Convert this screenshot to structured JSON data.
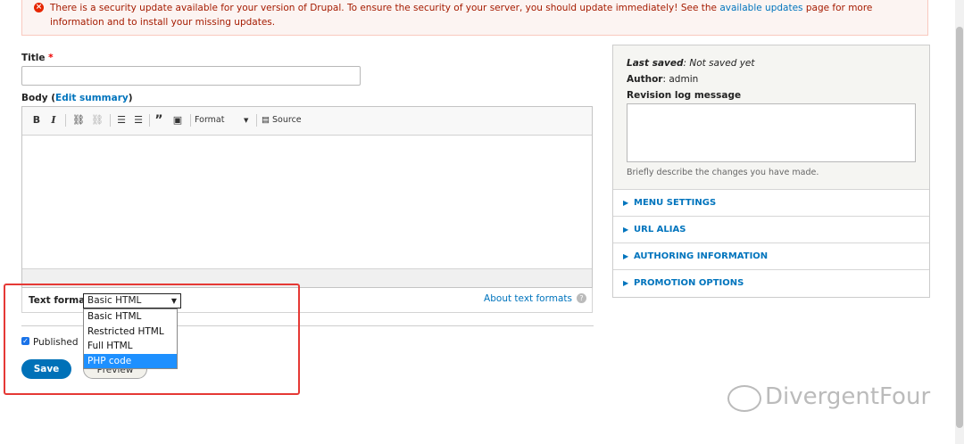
{
  "alert": {
    "text_before": "There is a security update available for your version of Drupal. To ensure the security of your server, you should update immediately! See the ",
    "link": "available updates",
    "text_after": " page for more information and to install your missing updates."
  },
  "form": {
    "title_label": "Title",
    "required_mark": "*",
    "title_value": "",
    "body_label": "Body (",
    "edit_summary": "Edit summary",
    "body_label_close": ")",
    "toolbar": {
      "bold": "B",
      "italic": "I",
      "format": "Format",
      "source": "Source"
    },
    "text_format_label": "Text format",
    "text_format_value": "Basic HTML",
    "text_format_options": [
      "Basic HTML",
      "Restricted HTML",
      "Full HTML",
      "PHP code"
    ],
    "text_format_highlighted": "PHP code",
    "about_text_formats": "About text formats",
    "published_label": "Published",
    "published_checked": true,
    "save_button": "Save",
    "preview_button": "Preview"
  },
  "sidebar": {
    "last_saved_label": "Last saved",
    "last_saved_value": ": Not saved yet",
    "author_label": "Author",
    "author_value": ": admin",
    "revision_label": "Revision log message",
    "revision_desc": "Briefly describe the changes you have made.",
    "sections": [
      "MENU SETTINGS",
      "URL ALIAS",
      "AUTHORING INFORMATION",
      "PROMOTION OPTIONS"
    ]
  },
  "watermark": "DivergentFour",
  "colors": {
    "accent": "#0074bd",
    "error": "#a51b00",
    "highlight_border": "#e53935",
    "selected_option": "#1e90ff"
  }
}
